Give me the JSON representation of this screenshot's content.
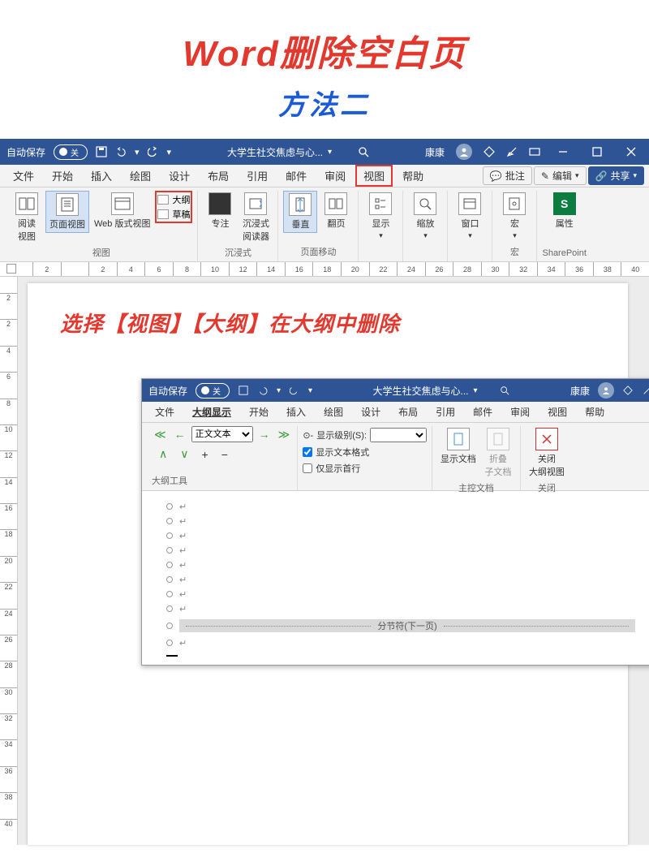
{
  "title": {
    "main": "Word删除空白页",
    "sub": "方法二"
  },
  "outer": {
    "titlebar": {
      "autosave_label": "自动保存",
      "autosave_state": "关",
      "doc_title": "大学生社交焦虑与心...",
      "user": "康康"
    },
    "tabs": {
      "file": "文件",
      "home": "开始",
      "insert": "插入",
      "draw": "绘图",
      "design": "设计",
      "layout": "布局",
      "references": "引用",
      "mailings": "邮件",
      "review": "审阅",
      "view": "视图",
      "help": "帮助"
    },
    "right_buttons": {
      "comment": "批注",
      "edit": "编辑",
      "share": "共享"
    },
    "ribbon": {
      "views_group": "视图",
      "read_view": "阅读\n视图",
      "page_view": "页面视图",
      "web_view": "Web 版式视图",
      "outline": "大纲",
      "draft": "草稿",
      "immersive_group": "沉浸式",
      "focus": "专注",
      "immersive_reader": "沉浸式\n阅读器",
      "page_move_group": "页面移动",
      "vertical": "垂直",
      "flip": "翻页",
      "show": "显示",
      "zoom": "缩放",
      "window": "窗口",
      "macro_group": "宏",
      "macro": "宏",
      "sharepoint_group": "SharePoint",
      "properties": "属性"
    }
  },
  "instruction": "选择【视图】【大纲】在大纲中删除",
  "inner": {
    "titlebar": {
      "autosave_label": "自动保存",
      "autosave_state": "关",
      "doc_title": "大学生社交焦虑与心...",
      "user": "康康"
    },
    "tabs": {
      "file": "文件",
      "outline_display": "大纲显示",
      "home": "开始",
      "insert": "插入",
      "draw": "绘图",
      "design": "设计",
      "layout": "布局",
      "references": "引用",
      "mailings": "邮件",
      "review": "审阅",
      "view": "视图",
      "help": "帮助"
    },
    "ribbon": {
      "body_text": "正文文本",
      "show_level": "显示级别(S):",
      "show_formatting": "显示文本格式",
      "show_first_line": "仅显示首行",
      "tools_group": "大纲工具",
      "show_doc": "显示文档",
      "collapse_sub": "折叠\n子文档",
      "master_group": "主控文档",
      "close_outline": "关闭\n大纲视图",
      "close_group": "关闭"
    },
    "section_break": "分节符(下一页)"
  },
  "ruler_v": [
    "2",
    "2",
    "4",
    "6",
    "8",
    "10",
    "12",
    "14",
    "16",
    "18",
    "20",
    "22",
    "24",
    "26",
    "28",
    "30",
    "32",
    "34",
    "36",
    "38",
    "40"
  ],
  "ruler_h": [
    "2",
    "",
    "2",
    "4",
    "6",
    "8",
    "10",
    "12",
    "14",
    "16",
    "18",
    "20",
    "22",
    "24",
    "26",
    "28",
    "30",
    "32",
    "34",
    "36",
    "38",
    "40"
  ]
}
